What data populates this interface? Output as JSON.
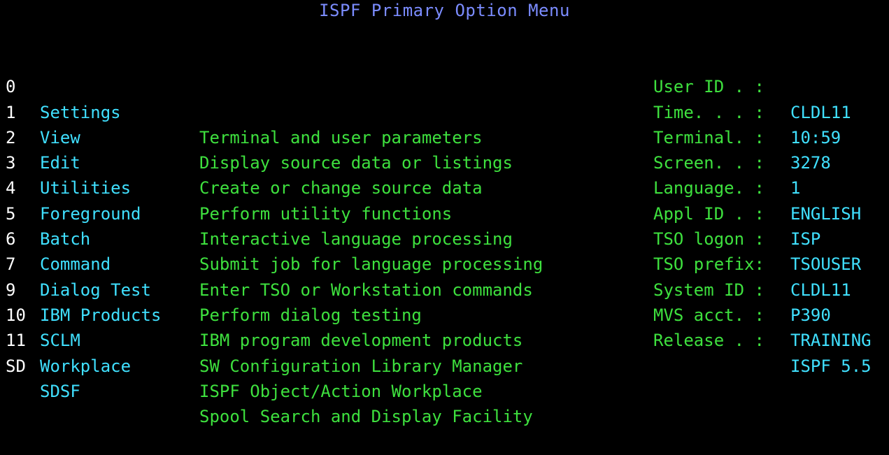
{
  "title": "ISPF Primary Option Menu",
  "colors": {
    "background": "#000000",
    "title": "#7b8cff",
    "option_name": "#40e0ff",
    "description": "#3ee03e",
    "option_number": "#ffffff",
    "info_value": "#40e0ff"
  },
  "menu": [
    {
      "opt": "0",
      "name": "Settings",
      "desc": "Terminal and user parameters"
    },
    {
      "opt": "1",
      "name": "View",
      "desc": "Display source data or listings"
    },
    {
      "opt": "2",
      "name": "Edit",
      "desc": "Create or change source data"
    },
    {
      "opt": "3",
      "name": "Utilities",
      "desc": "Perform utility functions"
    },
    {
      "opt": "4",
      "name": "Foreground",
      "desc": "Interactive language processing"
    },
    {
      "opt": "5",
      "name": "Batch",
      "desc": "Submit job for language processing"
    },
    {
      "opt": "6",
      "name": "Command",
      "desc": "Enter TSO or Workstation commands"
    },
    {
      "opt": "7",
      "name": "Dialog Test",
      "desc": "Perform dialog testing"
    },
    {
      "opt": "9",
      "name": "IBM Products",
      "desc": "IBM program development products"
    },
    {
      "opt": "10",
      "name": "SCLM",
      "desc": "SW Configuration Library Manager"
    },
    {
      "opt": "11",
      "name": "Workplace",
      "desc": "ISPF Object/Action Workplace"
    },
    {
      "opt": "SD",
      "name": "SDSF",
      "desc": "Spool Search and Display Facility"
    }
  ],
  "info": [
    {
      "label": "User ID . :",
      "value": "CLDL11"
    },
    {
      "label": "Time. . . :",
      "value": "10:59"
    },
    {
      "label": "Terminal. :",
      "value": "3278"
    },
    {
      "label": "Screen. . :",
      "value": "1"
    },
    {
      "label": "Language. :",
      "value": "ENGLISH"
    },
    {
      "label": "Appl ID . :",
      "value": "ISP"
    },
    {
      "label": "TSO logon :",
      "value": "TSOUSER"
    },
    {
      "label": "TSO prefix:",
      "value": "CLDL11"
    },
    {
      "label": "System ID :",
      "value": "P390"
    },
    {
      "label": "MVS acct. :",
      "value": "TRAINING"
    },
    {
      "label": "Release . :",
      "value": "ISPF 5.5"
    }
  ]
}
